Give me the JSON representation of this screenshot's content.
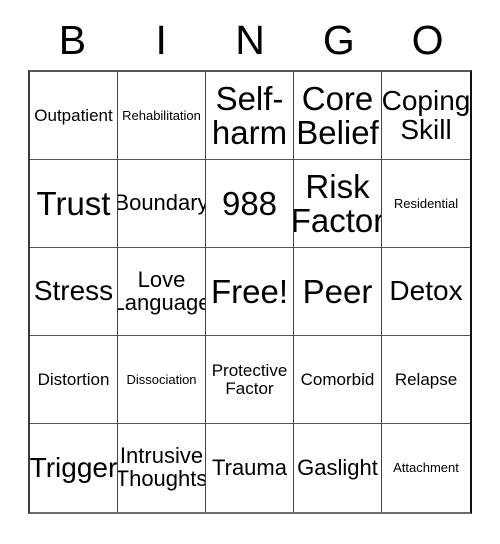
{
  "card": {
    "header_letters": [
      "B",
      "I",
      "N",
      "G",
      "O"
    ],
    "grid_size": "5x5",
    "free_space_label": "Free!",
    "colors": {
      "background": "#ffffff",
      "text": "#000000",
      "border": "#444444"
    },
    "rows": [
      [
        {
          "label": "Outpatient",
          "size": "sm"
        },
        {
          "label": "Rehabilitation",
          "size": "xs"
        },
        {
          "label": "Self-harm",
          "size": "xl"
        },
        {
          "label": "Core Belief",
          "size": "xl"
        },
        {
          "label": "Coping Skill",
          "size": "lg"
        }
      ],
      [
        {
          "label": "Trust",
          "size": "xl"
        },
        {
          "label": "Boundary",
          "size": "md"
        },
        {
          "label": "988",
          "size": "xl"
        },
        {
          "label": "Risk Factor",
          "size": "xl"
        },
        {
          "label": "Residential",
          "size": "xs"
        }
      ],
      [
        {
          "label": "Stress",
          "size": "lg"
        },
        {
          "label": "Love Language",
          "size": "md"
        },
        {
          "label": "Free!",
          "size": "xl"
        },
        {
          "label": "Peer",
          "size": "xl"
        },
        {
          "label": "Detox",
          "size": "lg"
        }
      ],
      [
        {
          "label": "Distortion",
          "size": "sm"
        },
        {
          "label": "Dissociation",
          "size": "xs"
        },
        {
          "label": "Protective Factor",
          "size": "sm"
        },
        {
          "label": "Comorbid",
          "size": "sm"
        },
        {
          "label": "Relapse",
          "size": "sm"
        }
      ],
      [
        {
          "label": "Trigger",
          "size": "lg"
        },
        {
          "label": "Intrusive Thoughts",
          "size": "md"
        },
        {
          "label": "Trauma",
          "size": "md"
        },
        {
          "label": "Gaslight",
          "size": "md"
        },
        {
          "label": "Attachment",
          "size": "xs"
        }
      ]
    ]
  }
}
